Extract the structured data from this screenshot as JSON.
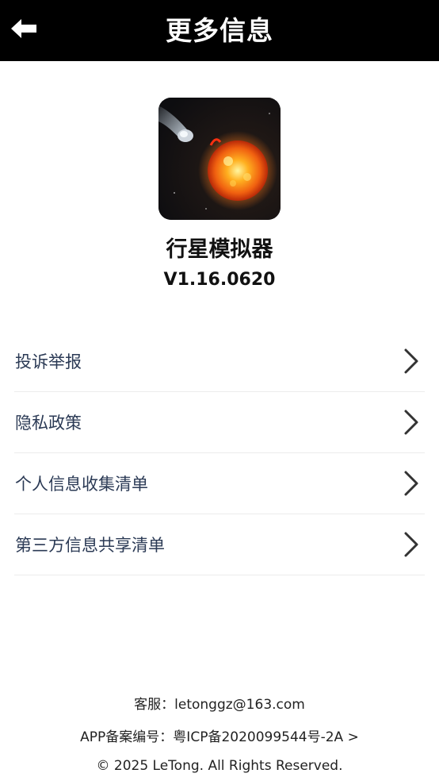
{
  "header": {
    "title": "更多信息",
    "back_icon": "arrow-left-icon"
  },
  "app": {
    "name": "行星模拟器",
    "version": "V1.16.0620"
  },
  "menu": {
    "items": [
      {
        "label": "投诉举报"
      },
      {
        "label": "隐私政策"
      },
      {
        "label": "个人信息收集清单"
      },
      {
        "label": "第三方信息共享清单"
      }
    ],
    "chevron_icon": "chevron-right-icon"
  },
  "footer": {
    "service": "客服：letonggz@163.com",
    "icp": "APP备案编号：粤ICP备2020099544号-2A >",
    "copyright": "© 2025 LeTong. All Rights Reserved."
  },
  "colors": {
    "header_bg": "#000000",
    "menu_text": "#2b3a55",
    "divider": "#ececec"
  }
}
